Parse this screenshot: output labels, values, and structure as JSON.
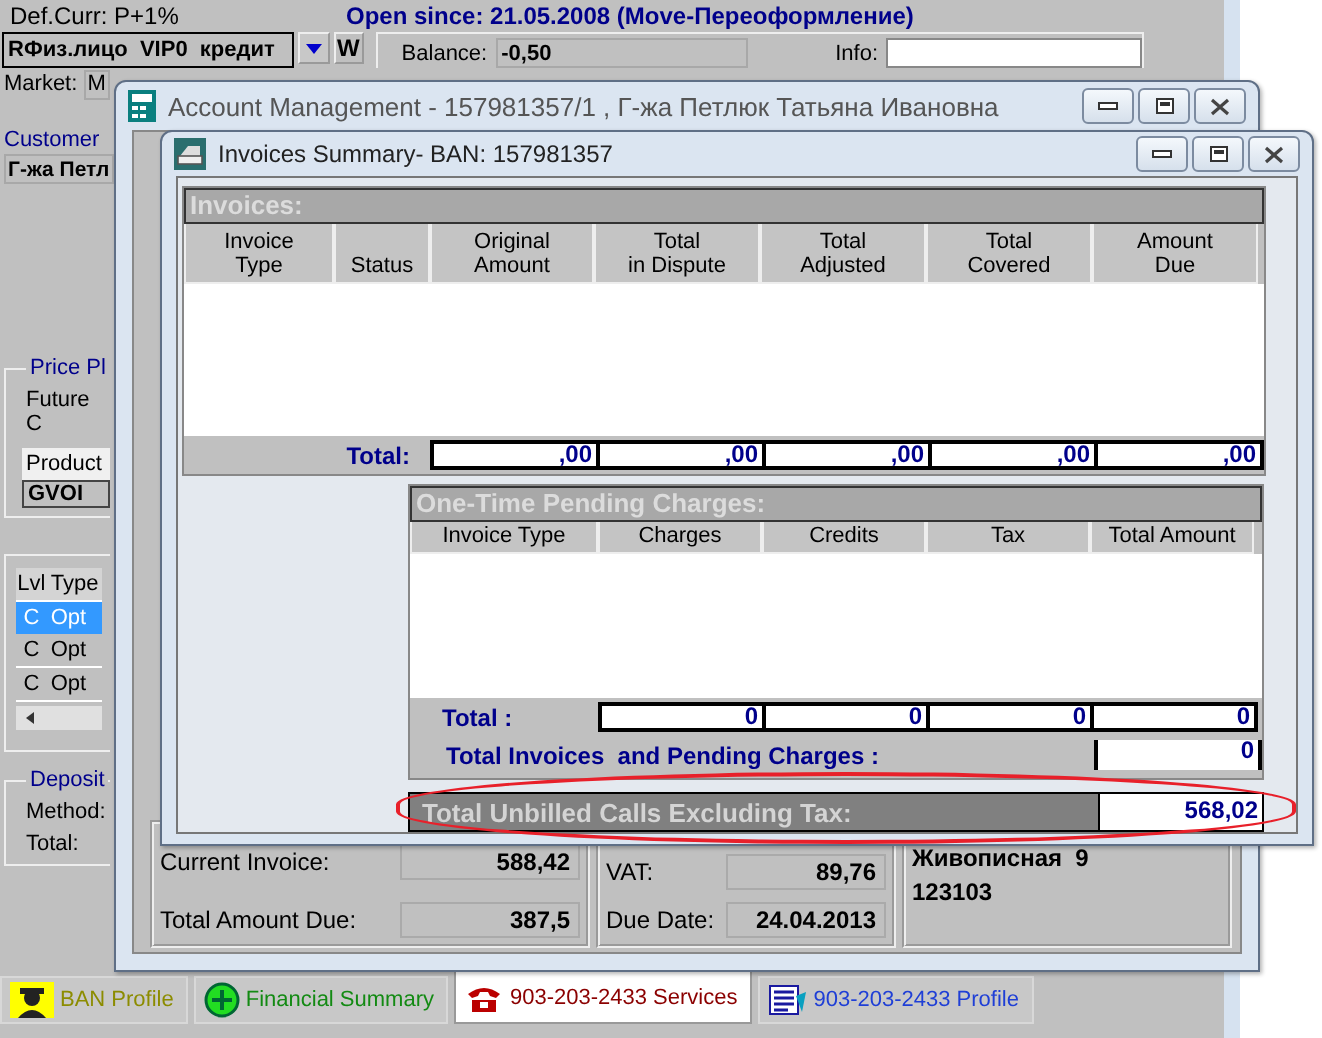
{
  "background_app": {
    "currency_label": "Def.Curr: P+1%",
    "open_since": "Open since: 21.05.2008 (Move-Переоформление)",
    "account_type": "RФиз.лицо  VIP0  кредит",
    "w_button": "W",
    "balance_label": "Balance:",
    "balance": "-0,50",
    "info_label": "Info:",
    "market_label": "Market:",
    "market_value": "M",
    "customer_label": "Customer",
    "customer_value": "Г-жа Петл",
    "price_plan_label": "Price Pl",
    "future_label": "Future C",
    "product_header": "Product",
    "product_value": "GVOI",
    "offers": {
      "columns": [
        "Lvl",
        "Type"
      ],
      "rows": [
        {
          "level": "C",
          "type": "Opt",
          "selected": true
        },
        {
          "level": "C",
          "type": "Opt",
          "selected": false
        },
        {
          "level": "C",
          "type": "Opt",
          "selected": false
        }
      ]
    },
    "deposit_label": "Deposit",
    "method_label": "Method:",
    "total_label": "Total:"
  },
  "tabs": [
    {
      "label": "BAN Profile",
      "kind": "person",
      "color": "#8c8c00",
      "selected": false
    },
    {
      "label": "Financial Summary",
      "kind": "money",
      "color": "#138a13",
      "selected": false
    },
    {
      "label": "903-203-2433 Services",
      "kind": "phone",
      "color": "#8b0000",
      "selected": true
    },
    {
      "label": "903-203-2433 Profile",
      "kind": "document",
      "color": "#1f3fd6",
      "selected": false
    }
  ],
  "account_management": {
    "title": "Account Management - 157981357/1 , Г-жа Петлюк Татьяна Ивановна",
    "summary": [
      {
        "label": "Current Invoice:",
        "value": "588,42"
      },
      {
        "label": "Total Amount Due:",
        "value": "387,5"
      }
    ],
    "billing": [
      {
        "label": "VAT:",
        "value": "89,76"
      },
      {
        "label": "Due Date:",
        "value": "24.04.2013"
      }
    ],
    "address": [
      "Живописная  9",
      "123103"
    ]
  },
  "invoices_summary": {
    "title": "Invoices Summary- BAN: 157981357",
    "invoices": {
      "heading": "Invoices:",
      "columns": [
        "Invoice\nType",
        "Status",
        "Original\nAmount",
        "Total\nin Dispute",
        "Total\nAdjusted",
        "Total\nCovered",
        "Amount\nDue"
      ],
      "total_label": "Total:",
      "totals": [
        ",00",
        ",00",
        ",00",
        ",00",
        ",00"
      ]
    },
    "pending": {
      "heading": "One-Time Pending Charges:",
      "columns": [
        "Invoice Type",
        "Charges",
        "Credits",
        "Tax",
        "Total Amount"
      ],
      "total_label": "Total :",
      "totals": [
        "0",
        "0",
        "0",
        "0"
      ],
      "grand_label": "Total Invoices  and Pending Charges :",
      "grand_total": "0"
    },
    "unbilled": {
      "label": "Total Unbilled Calls Excluding Tax:",
      "value": "568,02",
      "highlighted": true
    }
  }
}
